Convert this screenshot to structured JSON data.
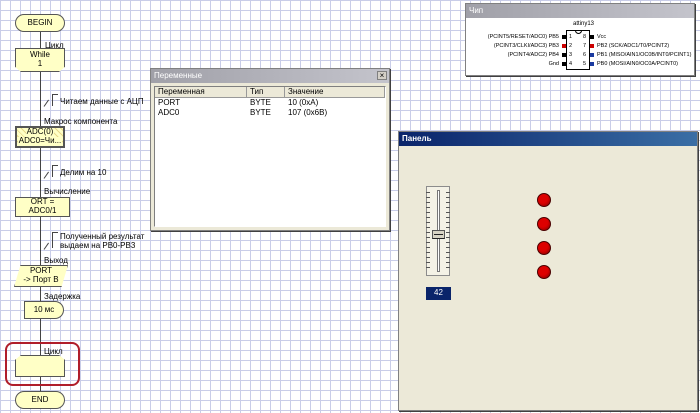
{
  "flowchart": {
    "begin": "BEGIN",
    "loop_label": "Цикл",
    "loop_block_line1": "While",
    "loop_block_line2": "1",
    "comment_read": "Читаем данные с АЦП",
    "macro_label": "Макрос компонента",
    "macro_line1": "ADC(0)",
    "macro_line2": "ADC0=Чи...",
    "comment_divide": "Делим на 10",
    "calc_label": "Вычисление",
    "calc_block": "ORT = ADC0/1",
    "comment_result_line1": "Полученный результат",
    "comment_result_line2": "выдаем на PB0-PB3",
    "output_label": "Выход",
    "output_line1": "PORT",
    "output_line2": "-> Порт B",
    "delay_label": "Задержка",
    "delay_block": "10 мс",
    "loop_end_label": "Цикл",
    "end": "END"
  },
  "variables_window": {
    "title": "Переменные",
    "columns": [
      "Переменная",
      "Тип",
      "Значение"
    ],
    "rows": [
      {
        "name": "PORT",
        "type": "BYTE",
        "value": "10 (0xA)"
      },
      {
        "name": "ADC0",
        "type": "BYTE",
        "value": "107 (0x6B)"
      }
    ]
  },
  "chip_window": {
    "title": "Чип",
    "chip_name": "attiny13",
    "left_pins": [
      {
        "label": "(PCINT5/RESET/ADC0) PB5",
        "num": "1",
        "color": "#000000"
      },
      {
        "label": "(PCINT3/CLKI/ADC3) PB3",
        "num": "2",
        "color": "#cc0000"
      },
      {
        "label": "(PCINT4/ADC2) PB4",
        "num": "3",
        "color": "#000000"
      },
      {
        "label": "Gnd",
        "num": "4",
        "color": "#000000"
      }
    ],
    "right_pins": [
      {
        "label": "Vcc",
        "num": "8",
        "color": "#000000"
      },
      {
        "label": "PB2 (SCK/ADC1/T0/PCINT2)",
        "num": "7",
        "color": "#cc0000"
      },
      {
        "label": "PB1 (MISO/AIN1/OC0B/INT0/PCINT1)",
        "num": "6",
        "color": "#1a3aa0"
      },
      {
        "label": "PB0 (MOSI/AIN0/OC0A/PCINT0)",
        "num": "5",
        "color": "#1a3aa0"
      }
    ]
  },
  "panel_window": {
    "title": "Панель",
    "slider_value": "42",
    "colors": {
      "led_on": "#dd0000",
      "led_dark": "#7a0000"
    }
  }
}
